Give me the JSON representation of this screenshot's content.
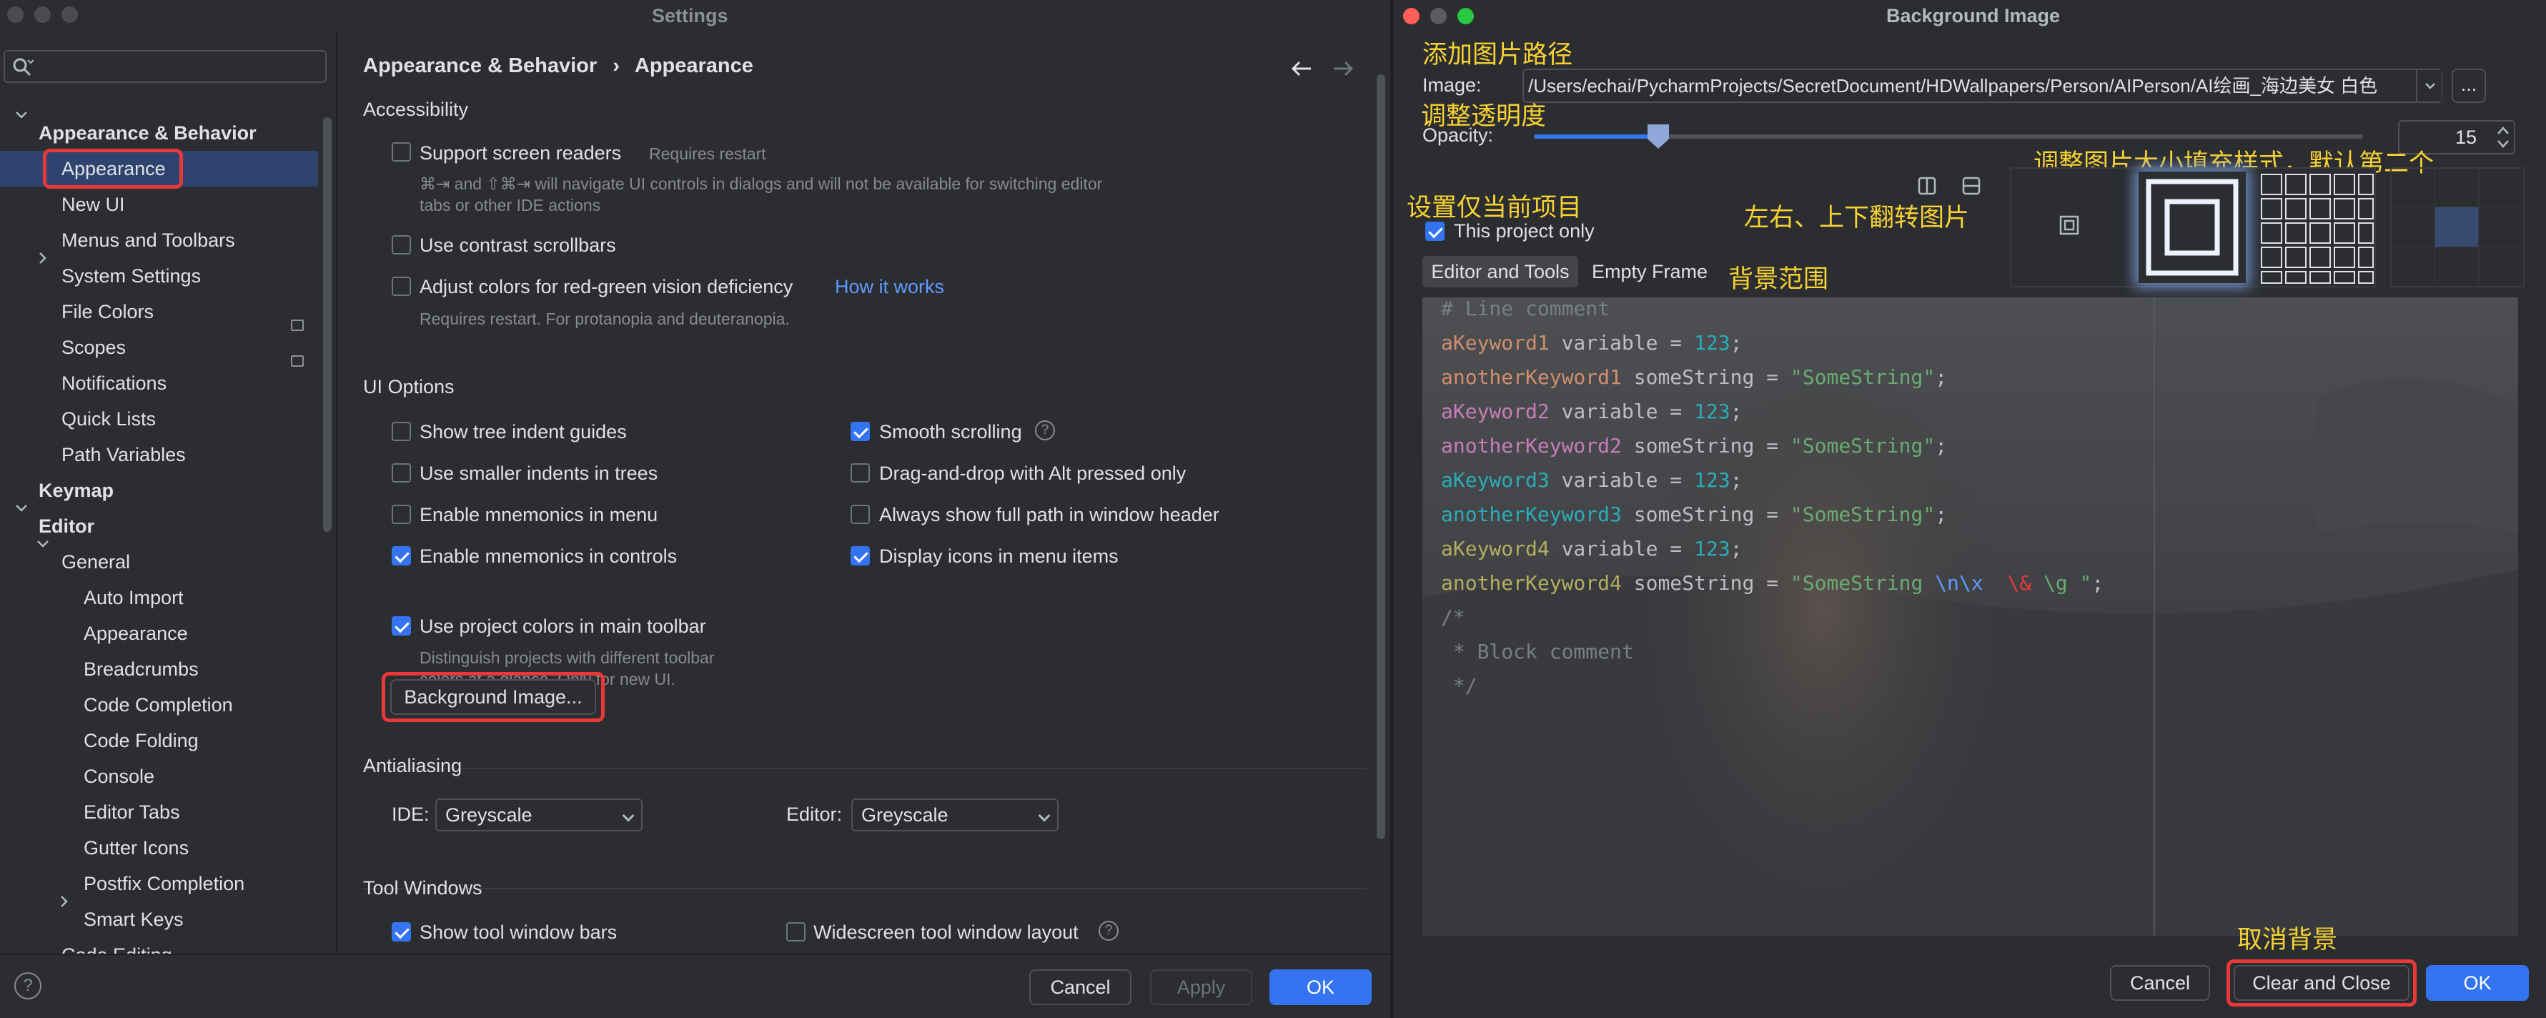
{
  "settings": {
    "window_title": "Settings",
    "search_placeholder": "",
    "sidebar": {
      "items": [
        {
          "label": "Appearance & Behavior"
        },
        {
          "label": "Appearance"
        },
        {
          "label": "New UI"
        },
        {
          "label": "Menus and Toolbars"
        },
        {
          "label": "System Settings"
        },
        {
          "label": "File Colors"
        },
        {
          "label": "Scopes"
        },
        {
          "label": "Notifications"
        },
        {
          "label": "Quick Lists"
        },
        {
          "label": "Path Variables"
        },
        {
          "label": "Keymap"
        },
        {
          "label": "Editor"
        },
        {
          "label": "General"
        },
        {
          "label": "Auto Import"
        },
        {
          "label": "Appearance"
        },
        {
          "label": "Breadcrumbs"
        },
        {
          "label": "Code Completion"
        },
        {
          "label": "Code Folding"
        },
        {
          "label": "Console"
        },
        {
          "label": "Editor Tabs"
        },
        {
          "label": "Gutter Icons"
        },
        {
          "label": "Postfix Completion"
        },
        {
          "label": "Smart Keys"
        },
        {
          "label": "Code Editing"
        }
      ]
    },
    "breadcrumb": {
      "parent": "Appearance & Behavior",
      "separator": "›",
      "current": "Appearance"
    },
    "accessibility": {
      "title": "Accessibility",
      "screen_readers": "Support screen readers",
      "screen_readers_hint": "Requires restart",
      "screen_readers_desc1": "⌘⇥ and ⇧⌘⇥ will navigate UI controls in dialogs and will not be available for switching editor",
      "screen_readers_desc2": "tabs or other IDE actions",
      "contrast_scrollbars": "Use contrast scrollbars",
      "red_green": "Adjust colors for red-green vision deficiency",
      "how_it_works": "How it works",
      "red_green_hint": "Requires restart. For protanopia and deuteranopia."
    },
    "ui_options": {
      "title": "UI Options",
      "left": [
        {
          "label": "Show tree indent guides",
          "checked": false
        },
        {
          "label": "Use smaller indents in trees",
          "checked": false
        },
        {
          "label": "Enable mnemonics in menu",
          "checked": false
        },
        {
          "label": "Enable mnemonics in controls",
          "checked": true
        },
        {
          "label": "Use project colors in main toolbar",
          "checked": true
        }
      ],
      "right": [
        {
          "label": "Smooth scrolling",
          "checked": true
        },
        {
          "label": "Drag-and-drop with Alt pressed only",
          "checked": false
        },
        {
          "label": "Always show full path in window header",
          "checked": false
        },
        {
          "label": "Display icons in menu items",
          "checked": true
        }
      ],
      "project_colors_hint1": "Distinguish projects with different toolbar",
      "project_colors_hint2": "colors at a glance. Only for new UI.",
      "background_image_button": "Background Image..."
    },
    "antialiasing": {
      "title": "Antialiasing",
      "ide_label": "IDE:",
      "ide_value": "Greyscale",
      "editor_label": "Editor:",
      "editor_value": "Greyscale"
    },
    "tool_windows": {
      "title": "Tool Windows",
      "show_bars": "Show tool window bars",
      "widescreen": "Widescreen tool window layout"
    },
    "footer": {
      "help": "?",
      "cancel": "Cancel",
      "apply": "Apply",
      "ok": "OK"
    }
  },
  "dialog": {
    "title": "Background Image",
    "image_label": "Image:",
    "image_path": "/Users/echai/PycharmProjects/SecretDocument/HDWallpapers/Person/AIPerson/AI绘画_海边美女 白色",
    "browse": "...",
    "opacity_label": "Opacity:",
    "opacity_value": "15",
    "opacity_fraction": 0.15,
    "this_project_only": "This project only",
    "tabs": [
      "Editor and Tools",
      "Empty Frame"
    ],
    "code_lines": [
      {
        "text": "# Line comment",
        "color": "#7a7e85"
      },
      {
        "parts": [
          {
            "t": "aKeyword1",
            "c": "#cf8e6d"
          },
          {
            "t": " variable = ",
            "c": "#bcbec4"
          },
          {
            "t": "123",
            "c": "#2aacb8"
          },
          {
            "t": ";",
            "c": "#bcbec4"
          }
        ]
      },
      {
        "parts": [
          {
            "t": "anotherKeyword1",
            "c": "#cf8e6d"
          },
          {
            "t": " someString = ",
            "c": "#bcbec4"
          },
          {
            "t": "\"SomeString\"",
            "c": "#6aab73"
          },
          {
            "t": ";",
            "c": "#bcbec4"
          }
        ]
      },
      {
        "parts": [
          {
            "t": "aKeyword2",
            "c": "#c77dbb"
          },
          {
            "t": " variable = ",
            "c": "#bcbec4"
          },
          {
            "t": "123",
            "c": "#2aacb8"
          },
          {
            "t": ";",
            "c": "#bcbec4"
          }
        ]
      },
      {
        "parts": [
          {
            "t": "anotherKeyword2",
            "c": "#c77dbb"
          },
          {
            "t": " someString = ",
            "c": "#bcbec4"
          },
          {
            "t": "\"SomeString\"",
            "c": "#6aab73"
          },
          {
            "t": ";",
            "c": "#bcbec4"
          }
        ]
      },
      {
        "parts": [
          {
            "t": "aKeyword3",
            "c": "#2aacb8"
          },
          {
            "t": " variable = ",
            "c": "#bcbec4"
          },
          {
            "t": "123",
            "c": "#2aacb8"
          },
          {
            "t": ";",
            "c": "#bcbec4"
          }
        ]
      },
      {
        "parts": [
          {
            "t": "anotherKeyword3",
            "c": "#2aacb8"
          },
          {
            "t": " someString = ",
            "c": "#bcbec4"
          },
          {
            "t": "\"SomeString\"",
            "c": "#6aab73"
          },
          {
            "t": ";",
            "c": "#bcbec4"
          }
        ]
      },
      {
        "parts": [
          {
            "t": "aKeyword4",
            "c": "#b3ae60"
          },
          {
            "t": " variable = ",
            "c": "#bcbec4"
          },
          {
            "t": "123",
            "c": "#2aacb8"
          },
          {
            "t": ";",
            "c": "#bcbec4"
          }
        ]
      },
      {
        "parts": [
          {
            "t": "anotherKeyword4",
            "c": "#b3ae60"
          },
          {
            "t": " someString = ",
            "c": "#bcbec4"
          },
          {
            "t": "\"SomeString ",
            "c": "#6aab73"
          },
          {
            "t": "\\n\\x",
            "c": "#5e9bff"
          },
          {
            "t": "  ",
            "c": "#6aab73"
          },
          {
            "t": "\\&",
            "c": "#e8383a"
          },
          {
            "t": " \\g ",
            "c": "#6aab73"
          },
          {
            "t": "\"",
            "c": "#6aab73"
          },
          {
            "t": ";",
            "c": "#bcbec4"
          }
        ]
      },
      {
        "text": "/*",
        "color": "#7a7e85"
      },
      {
        "text": " * Block comment",
        "color": "#7a7e85"
      },
      {
        "text": " */",
        "color": "#7a7e85"
      }
    ],
    "footer": {
      "cancel": "Cancel",
      "clear_and_close": "Clear and Close",
      "ok": "OK"
    },
    "annotations": {
      "add_path": "添加图片路径",
      "adjust_opacity": "调整透明度",
      "fill_style": "调整图片大小填充样式，默认第二个",
      "project_only": "设置仅当前项目",
      "flip": "左右、上下翻转图片",
      "scope": "背景范围",
      "cancel_bg": "取消背景"
    }
  },
  "colors": {
    "accent": "#3574f0",
    "highlight_red": "#e8383a",
    "annotation_yellow": "#f7d233"
  }
}
